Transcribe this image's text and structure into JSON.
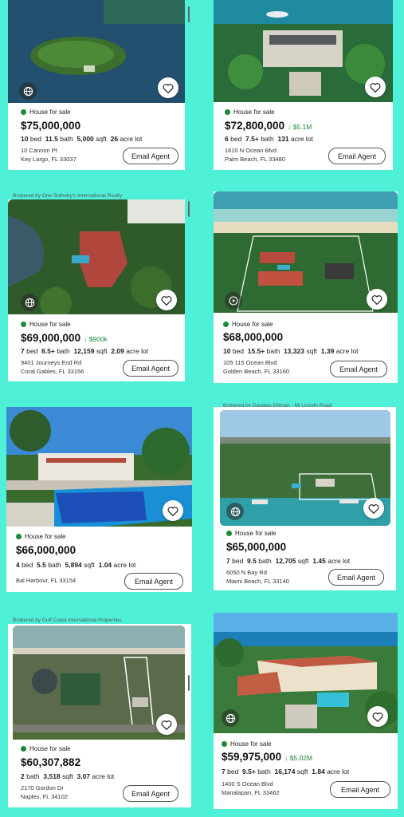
{
  "ui": {
    "status_label": "House for sale",
    "email_label": "Email Agent"
  },
  "brokers": {
    "c3": "Brokered by One Sotheby's International Realty",
    "c6": "Brokered by Douglas Elliman - Mi Lincoln Road",
    "c7": "Brokered by Gulf Coast International Properties"
  },
  "listings": [
    {
      "price": "$75,000,000",
      "drop": "",
      "bed": "10",
      "bath": "11.5",
      "sqft": "5,000",
      "lot": "26",
      "street": "10 Cannon Pt",
      "city": "Key Largo, FL 33037"
    },
    {
      "price": "$72,800,000",
      "drop": "↓ $5.1M",
      "bed": "6",
      "bath": "7.5+",
      "sqft": "",
      "lot": "131",
      "street": "1610 N Ocean Blvd",
      "city": "Palm Beach, FL 33480"
    },
    {
      "price": "$69,000,000",
      "drop": "↓ $900k",
      "bed": "7",
      "bath": "8.5+",
      "sqft": "12,159",
      "lot": "2.09",
      "street": "9401 Journeys End Rd",
      "city": "Coral Gables, FL 33156"
    },
    {
      "price": "$68,000,000",
      "drop": "",
      "bed": "10",
      "bath": "15.5+",
      "sqft": "13,323",
      "lot": "1.39",
      "street": "105 115 Ocean Blvd",
      "city": "Golden Beach, FL 33160"
    },
    {
      "price": "$66,000,000",
      "drop": "",
      "bed": "4",
      "bath": "5.5",
      "sqft": "5,894",
      "lot": "1.04",
      "street": "",
      "city": "Bal Harbour, FL 33154"
    },
    {
      "price": "$65,000,000",
      "drop": "",
      "bed": "7",
      "bath": "9.5",
      "sqft": "12,705",
      "lot": "1.45",
      "street": "6050 N Bay Rd",
      "city": "Miami Beach, FL 33140"
    },
    {
      "price": "$60,307,882",
      "drop": "",
      "bed": "",
      "bath": "2",
      "sqft": "3,518",
      "lot": "3.07",
      "street": "2170 Gordon Dr",
      "city": "Naples, FL 34102"
    },
    {
      "price": "$59,975,000",
      "drop": "↓ $5.02M",
      "bed": "7",
      "bath": "9.5+",
      "sqft": "16,174",
      "lot": "1.84",
      "street": "1400 S Ocean Blvd",
      "city": "Manalapan, FL 33462"
    }
  ],
  "units": {
    "bed": "bed",
    "bath": "bath",
    "sqft": "sqft",
    "lot": "acre lot"
  },
  "colors": {
    "page_bg": "#4ff0d8",
    "status_dot": "#1a8a3a",
    "price_drop": "#1a8a3a"
  }
}
